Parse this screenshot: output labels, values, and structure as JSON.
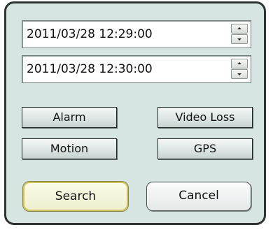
{
  "time_range": {
    "start": "2011/03/28 12:29:00",
    "end": "2011/03/28 12:30:00"
  },
  "filters": {
    "alarm": "Alarm",
    "video_loss": "Video Loss",
    "motion": "Motion",
    "gps": "GPS"
  },
  "actions": {
    "search": "Search",
    "cancel": "Cancel"
  },
  "colors": {
    "dialog_background": "#d6e5e2",
    "focus_highlight": "#cfc35a"
  },
  "icons": {
    "spin_up": "spin-up-arrow-icon",
    "spin_down": "spin-down-arrow-icon"
  }
}
